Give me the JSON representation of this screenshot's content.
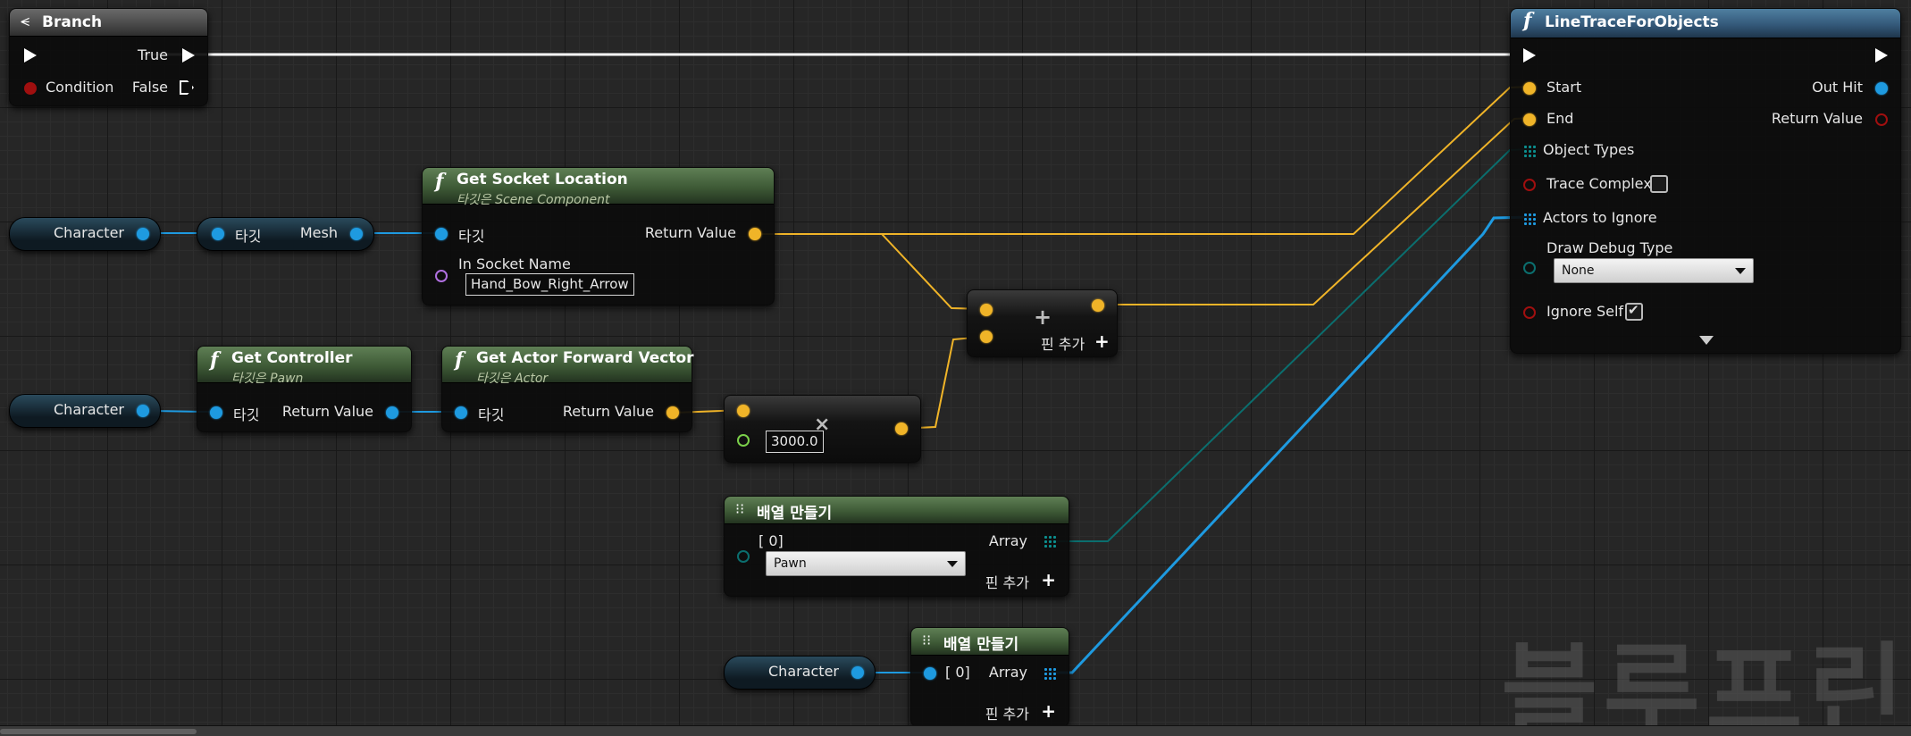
{
  "nodes": {
    "branch": {
      "title": "Branch",
      "true_label": "True",
      "false_label": "False",
      "condition_label": "Condition"
    },
    "get_socket_location": {
      "title": "Get Socket Location",
      "subtitle": "타깃은 Scene Component",
      "target_label": "타깃",
      "return_label": "Return Value",
      "socket_name_label": "In Socket Name",
      "socket_name_value": "Hand_Bow_Right_Arrow"
    },
    "character_var_1": {
      "label": "Character"
    },
    "mesh_getter": {
      "target_label": "타깃",
      "output_label": "Mesh"
    },
    "character_var_2": {
      "label": "Character"
    },
    "get_controller": {
      "title": "Get Controller",
      "subtitle": "타깃은 Pawn",
      "target_label": "타깃",
      "return_label": "Return Value"
    },
    "get_actor_forward_vector": {
      "title": "Get Actor Forward Vector",
      "subtitle": "타깃은 Actor",
      "target_label": "타깃",
      "return_label": "Return Value"
    },
    "multiply": {
      "operator": "×",
      "value": "3000.0"
    },
    "add": {
      "operator": "+",
      "add_pin_label": "핀 추가"
    },
    "make_array_1": {
      "title": "배열 만들기",
      "index_label": "[ 0]",
      "array_label": "Array",
      "selected_option": "Pawn",
      "add_pin_label": "핀 추가"
    },
    "character_var_3": {
      "label": "Character"
    },
    "make_array_2": {
      "title": "배열 만들기",
      "index_label": "[ 0]",
      "array_label": "Array",
      "add_pin_label": "핀 추가"
    },
    "line_trace": {
      "title": "LineTraceForObjects",
      "start_label": "Start",
      "end_label": "End",
      "object_types_label": "Object Types",
      "trace_complex_label": "Trace Complex",
      "trace_complex_checked": false,
      "actors_to_ignore_label": "Actors to Ignore",
      "draw_debug_label": "Draw Debug Type",
      "draw_debug_value": "None",
      "ignore_self_label": "Ignore Self",
      "ignore_self_checked": true,
      "out_hit_label": "Out Hit",
      "return_label": "Return Value"
    }
  },
  "watermark": "블루프린트",
  "colors": {
    "exec": "#ffffff",
    "object_pin": "#1e9ae0",
    "vector_pin": "#f0b428",
    "bool_pin": "#a00f0f",
    "name_pin": "#b070e0",
    "float_pin": "#7bd04a",
    "enum_pin": "#0b6e6e",
    "function_header": "#4a6b40",
    "trace_header": "#3a6a8c"
  }
}
